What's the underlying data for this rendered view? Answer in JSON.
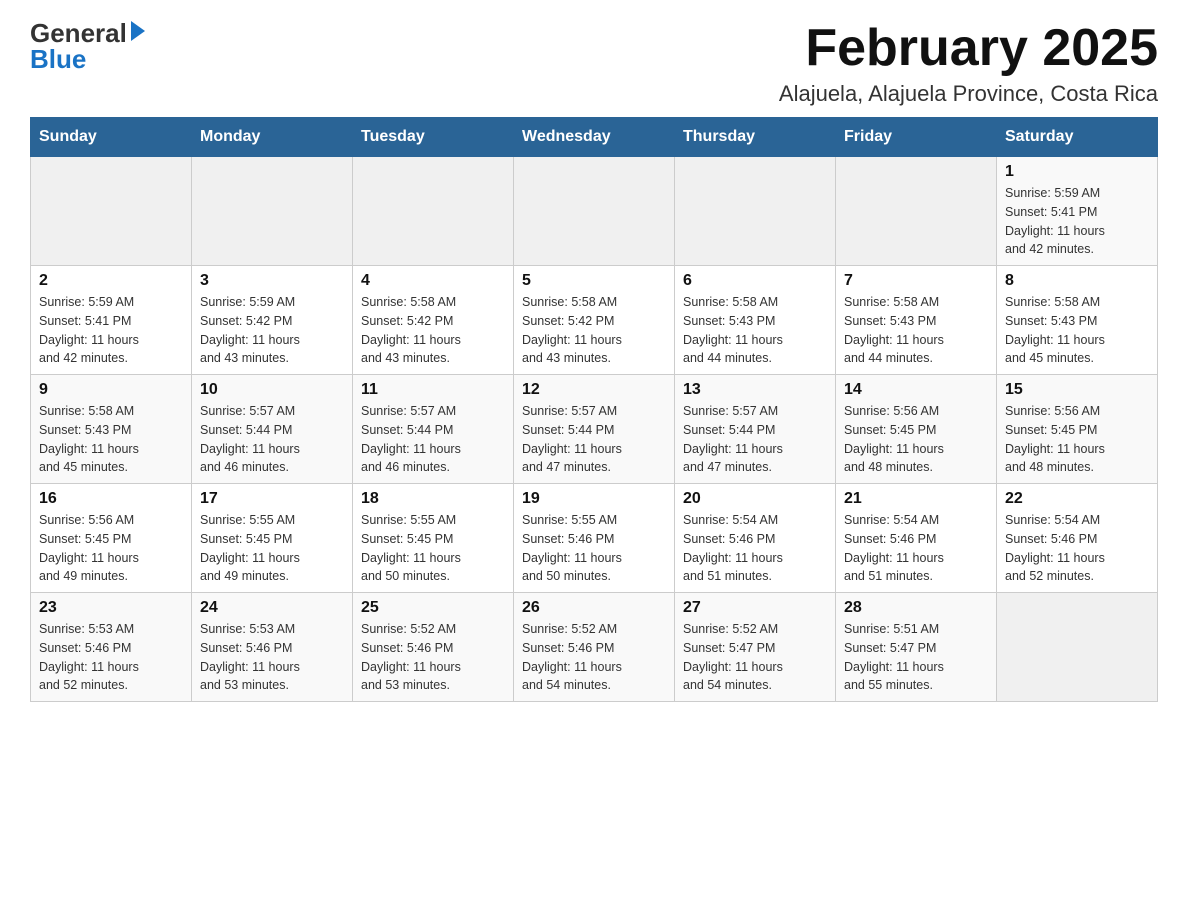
{
  "header": {
    "logo_general": "General",
    "logo_blue": "Blue",
    "month_title": "February 2025",
    "location": "Alajuela, Alajuela Province, Costa Rica"
  },
  "days_of_week": [
    "Sunday",
    "Monday",
    "Tuesday",
    "Wednesday",
    "Thursday",
    "Friday",
    "Saturday"
  ],
  "weeks": [
    [
      {
        "day": "",
        "info": ""
      },
      {
        "day": "",
        "info": ""
      },
      {
        "day": "",
        "info": ""
      },
      {
        "day": "",
        "info": ""
      },
      {
        "day": "",
        "info": ""
      },
      {
        "day": "",
        "info": ""
      },
      {
        "day": "1",
        "info": "Sunrise: 5:59 AM\nSunset: 5:41 PM\nDaylight: 11 hours\nand 42 minutes."
      }
    ],
    [
      {
        "day": "2",
        "info": "Sunrise: 5:59 AM\nSunset: 5:41 PM\nDaylight: 11 hours\nand 42 minutes."
      },
      {
        "day": "3",
        "info": "Sunrise: 5:59 AM\nSunset: 5:42 PM\nDaylight: 11 hours\nand 43 minutes."
      },
      {
        "day": "4",
        "info": "Sunrise: 5:58 AM\nSunset: 5:42 PM\nDaylight: 11 hours\nand 43 minutes."
      },
      {
        "day": "5",
        "info": "Sunrise: 5:58 AM\nSunset: 5:42 PM\nDaylight: 11 hours\nand 43 minutes."
      },
      {
        "day": "6",
        "info": "Sunrise: 5:58 AM\nSunset: 5:43 PM\nDaylight: 11 hours\nand 44 minutes."
      },
      {
        "day": "7",
        "info": "Sunrise: 5:58 AM\nSunset: 5:43 PM\nDaylight: 11 hours\nand 44 minutes."
      },
      {
        "day": "8",
        "info": "Sunrise: 5:58 AM\nSunset: 5:43 PM\nDaylight: 11 hours\nand 45 minutes."
      }
    ],
    [
      {
        "day": "9",
        "info": "Sunrise: 5:58 AM\nSunset: 5:43 PM\nDaylight: 11 hours\nand 45 minutes."
      },
      {
        "day": "10",
        "info": "Sunrise: 5:57 AM\nSunset: 5:44 PM\nDaylight: 11 hours\nand 46 minutes."
      },
      {
        "day": "11",
        "info": "Sunrise: 5:57 AM\nSunset: 5:44 PM\nDaylight: 11 hours\nand 46 minutes."
      },
      {
        "day": "12",
        "info": "Sunrise: 5:57 AM\nSunset: 5:44 PM\nDaylight: 11 hours\nand 47 minutes."
      },
      {
        "day": "13",
        "info": "Sunrise: 5:57 AM\nSunset: 5:44 PM\nDaylight: 11 hours\nand 47 minutes."
      },
      {
        "day": "14",
        "info": "Sunrise: 5:56 AM\nSunset: 5:45 PM\nDaylight: 11 hours\nand 48 minutes."
      },
      {
        "day": "15",
        "info": "Sunrise: 5:56 AM\nSunset: 5:45 PM\nDaylight: 11 hours\nand 48 minutes."
      }
    ],
    [
      {
        "day": "16",
        "info": "Sunrise: 5:56 AM\nSunset: 5:45 PM\nDaylight: 11 hours\nand 49 minutes."
      },
      {
        "day": "17",
        "info": "Sunrise: 5:55 AM\nSunset: 5:45 PM\nDaylight: 11 hours\nand 49 minutes."
      },
      {
        "day": "18",
        "info": "Sunrise: 5:55 AM\nSunset: 5:45 PM\nDaylight: 11 hours\nand 50 minutes."
      },
      {
        "day": "19",
        "info": "Sunrise: 5:55 AM\nSunset: 5:46 PM\nDaylight: 11 hours\nand 50 minutes."
      },
      {
        "day": "20",
        "info": "Sunrise: 5:54 AM\nSunset: 5:46 PM\nDaylight: 11 hours\nand 51 minutes."
      },
      {
        "day": "21",
        "info": "Sunrise: 5:54 AM\nSunset: 5:46 PM\nDaylight: 11 hours\nand 51 minutes."
      },
      {
        "day": "22",
        "info": "Sunrise: 5:54 AM\nSunset: 5:46 PM\nDaylight: 11 hours\nand 52 minutes."
      }
    ],
    [
      {
        "day": "23",
        "info": "Sunrise: 5:53 AM\nSunset: 5:46 PM\nDaylight: 11 hours\nand 52 minutes."
      },
      {
        "day": "24",
        "info": "Sunrise: 5:53 AM\nSunset: 5:46 PM\nDaylight: 11 hours\nand 53 minutes."
      },
      {
        "day": "25",
        "info": "Sunrise: 5:52 AM\nSunset: 5:46 PM\nDaylight: 11 hours\nand 53 minutes."
      },
      {
        "day": "26",
        "info": "Sunrise: 5:52 AM\nSunset: 5:46 PM\nDaylight: 11 hours\nand 54 minutes."
      },
      {
        "day": "27",
        "info": "Sunrise: 5:52 AM\nSunset: 5:47 PM\nDaylight: 11 hours\nand 54 minutes."
      },
      {
        "day": "28",
        "info": "Sunrise: 5:51 AM\nSunset: 5:47 PM\nDaylight: 11 hours\nand 55 minutes."
      },
      {
        "day": "",
        "info": ""
      }
    ]
  ]
}
